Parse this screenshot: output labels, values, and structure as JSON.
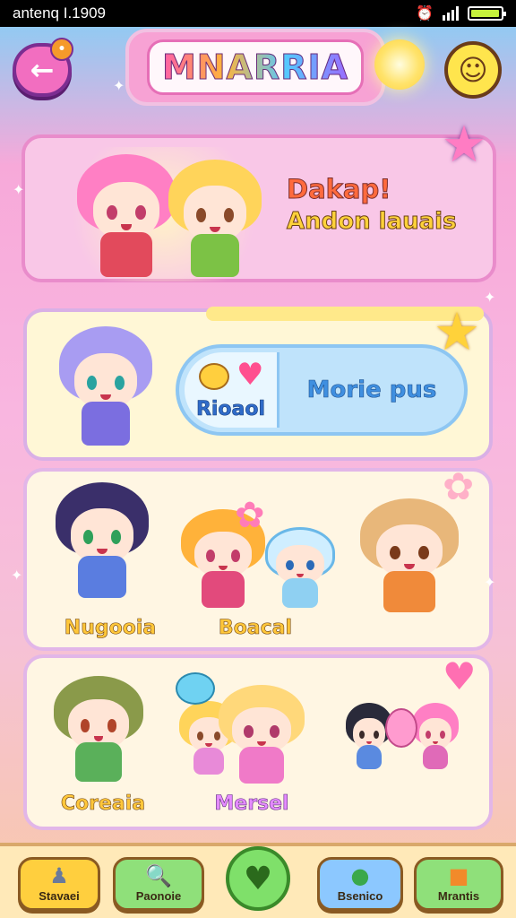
{
  "status_bar": {
    "carrier": "antenq I.1909"
  },
  "header": {
    "title": "MNARRIA"
  },
  "hero": {
    "title": "Dakap!",
    "subtitle": "Andon lauais"
  },
  "featured": {
    "combo_label": "Rioaol",
    "more_label": "Morie pus"
  },
  "grid": {
    "row1": [
      {
        "label": "Nugooia"
      },
      {
        "label": "Boacal"
      },
      {
        "label": ""
      }
    ],
    "row2": [
      {
        "label": "Coreaia"
      },
      {
        "label": "Mersel"
      },
      {
        "label": ""
      }
    ]
  },
  "tabs": [
    {
      "label": "Stavaei",
      "icon": "chess-piece-icon"
    },
    {
      "label": "Paonoie",
      "icon": "magnifier-icon"
    },
    {
      "label": "",
      "icon": "heart-check-icon"
    },
    {
      "label": "Bsenico",
      "icon": "green-monster-icon"
    },
    {
      "label": "Mrantis",
      "icon": "orange-block-icon"
    }
  ],
  "colors": {
    "accent_pink": "#f26ec0",
    "tab_yellow": "#ffcf3e",
    "tab_green": "#8fe07a",
    "tab_blue": "#8cc8ff"
  }
}
